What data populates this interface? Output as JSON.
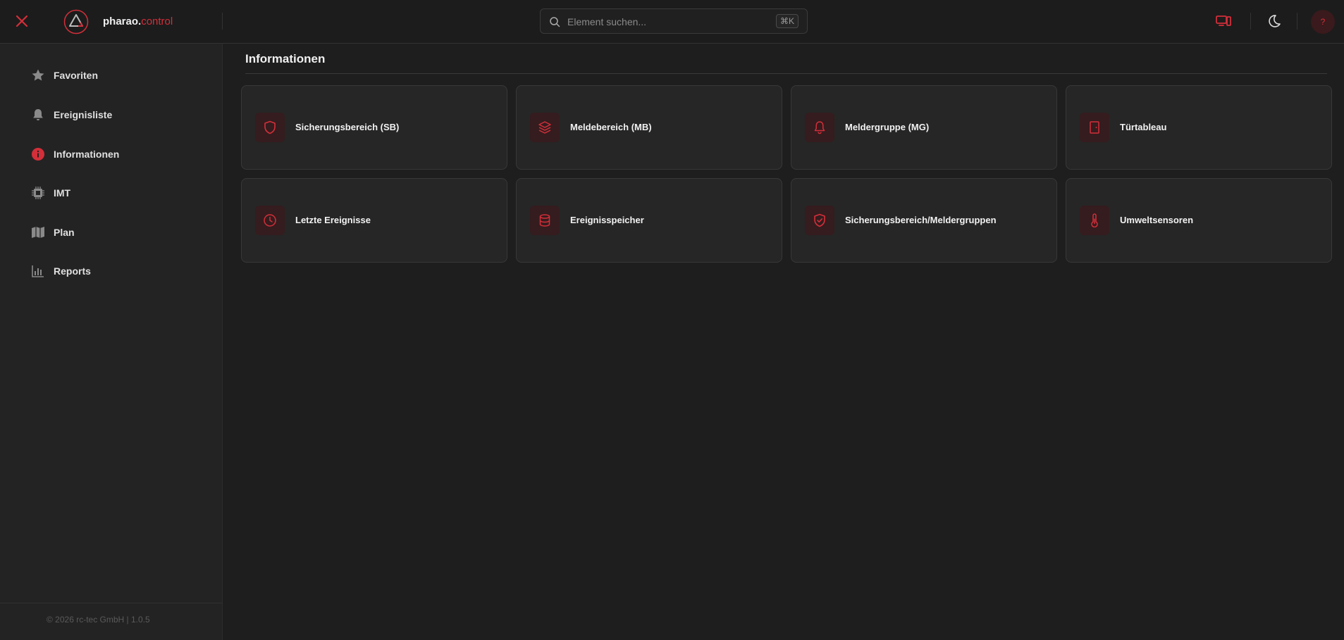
{
  "header": {
    "brand_main": "pharao.",
    "brand_accent": "control",
    "search_placeholder": "Element suchen...",
    "search_shortcut": "⌘K",
    "avatar_text": "?"
  },
  "sidebar": {
    "items": [
      {
        "label": "Favoriten",
        "icon": "star-icon"
      },
      {
        "label": "Ereignisliste",
        "icon": "bell-icon"
      },
      {
        "label": "Informationen",
        "icon": "info-icon",
        "active": true
      },
      {
        "label": "IMT",
        "icon": "chip-icon"
      },
      {
        "label": "Plan",
        "icon": "map-icon"
      },
      {
        "label": "Reports",
        "icon": "bar-chart-icon"
      }
    ],
    "footer": "© 2026 rc-tec GmbH | 1.0.5"
  },
  "main": {
    "title": "Informationen",
    "cards": [
      {
        "label": "Sicherungsbereich (SB)",
        "icon": "shield-icon"
      },
      {
        "label": "Meldebereich (MB)",
        "icon": "layers-icon"
      },
      {
        "label": "Meldergruppe (MG)",
        "icon": "bell-icon"
      },
      {
        "label": "Türtableau",
        "icon": "door-icon"
      },
      {
        "label": "Letzte Ereignisse",
        "icon": "clock-icon"
      },
      {
        "label": "Ereignisspeicher",
        "icon": "database-icon"
      },
      {
        "label": "Sicherungsbereich/Meldergruppen",
        "icon": "shield-check-icon"
      },
      {
        "label": "Umweltsensoren",
        "icon": "thermometer-icon"
      }
    ]
  },
  "colors": {
    "accent": "#d32f3a",
    "background": "#1e1e1e",
    "sidebar": "#232323",
    "card": "#262626"
  }
}
